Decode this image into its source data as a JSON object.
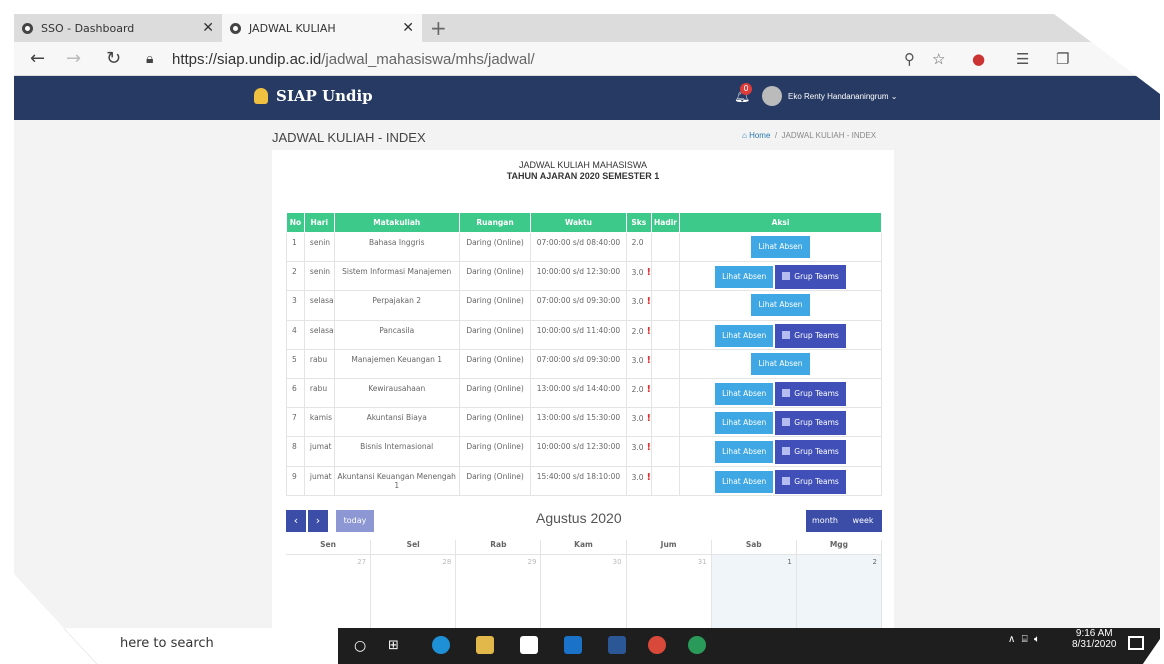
{
  "browser": {
    "tabs": [
      {
        "label": "SSO - Dashboard"
      },
      {
        "label": "JADWAL KULIAH"
      }
    ],
    "url_base": "https://siap.undip.ac.id",
    "url_path": "/jadwal_mahasiswa/mhs/jadwal/"
  },
  "header": {
    "brand": "SIAP Undip",
    "notif_count": "0",
    "user": "Eko Renty Handananingrum"
  },
  "page": {
    "title": "JADWAL KULIAH - INDEX",
    "crumb_home": "Home",
    "crumb_current": "JADWAL KULIAH - INDEX"
  },
  "card": {
    "title1": "JADWAL KULIAH MAHASISWA",
    "title2": "TAHUN AJARAN 2020 SEMESTER 1"
  },
  "table": {
    "headers": [
      "No",
      "Hari",
      "Matakuliah",
      "Ruangan",
      "Waktu",
      "Sks",
      "Hadir",
      "Aksi"
    ],
    "lihat_absen": "Lihat Absen",
    "grup_teams": "Grup Teams",
    "rows": [
      {
        "no": "1",
        "hari": "senin",
        "mk": "Bahasa Inggris",
        "ruang": "Daring (Online)",
        "waktu": "07:00:00 s/d 08:40:00",
        "sks": "2.0",
        "mark": "",
        "teams": false
      },
      {
        "no": "2",
        "hari": "senin",
        "mk": "Sistem Informasi Manajemen",
        "ruang": "Daring (Online)",
        "waktu": "10:00:00 s/d 12:30:00",
        "sks": "3.0",
        "mark": "!",
        "teams": true
      },
      {
        "no": "3",
        "hari": "selasa",
        "mk": "Perpajakan 2",
        "ruang": "Daring (Online)",
        "waktu": "07:00:00 s/d 09:30:00",
        "sks": "3.0",
        "mark": "!",
        "teams": false
      },
      {
        "no": "4",
        "hari": "selasa",
        "mk": "Pancasila",
        "ruang": "Daring (Online)",
        "waktu": "10:00:00 s/d 11:40:00",
        "sks": "2.0",
        "mark": "!",
        "teams": true
      },
      {
        "no": "5",
        "hari": "rabu",
        "mk": "Manajemen Keuangan 1",
        "ruang": "Daring (Online)",
        "waktu": "07:00:00 s/d 09:30:00",
        "sks": "3.0",
        "mark": "!",
        "teams": false
      },
      {
        "no": "6",
        "hari": "rabu",
        "mk": "Kewirausahaan",
        "ruang": "Daring (Online)",
        "waktu": "13:00:00 s/d 14:40:00",
        "sks": "2.0",
        "mark": "!",
        "teams": true
      },
      {
        "no": "7",
        "hari": "kamis",
        "mk": "Akuntansi Biaya",
        "ruang": "Daring (Online)",
        "waktu": "13:00:00 s/d 15:30:00",
        "sks": "3.0",
        "mark": "!",
        "teams": true
      },
      {
        "no": "8",
        "hari": "jumat",
        "mk": "Bisnis Internasional",
        "ruang": "Daring (Online)",
        "waktu": "10:00:00 s/d 12:30:00",
        "sks": "3.0",
        "mark": "!",
        "teams": true
      },
      {
        "no": "9",
        "hari": "jumat",
        "mk": "Akuntansi Keuangan Menengah 1",
        "ruang": "Daring (Online)",
        "waktu": "15:40:00 s/d 18:10:00",
        "sks": "3.0",
        "mark": "!",
        "teams": true
      }
    ]
  },
  "calendar": {
    "prev": "‹",
    "next": "›",
    "today": "today",
    "month": "Agustus 2020",
    "view_month": "month",
    "view_week": "week",
    "days": [
      "Sen",
      "Sel",
      "Rab",
      "Kam",
      "Jum",
      "Sab",
      "Mgg"
    ],
    "first_row": [
      "27",
      "28",
      "29",
      "30",
      "31",
      "1",
      "2"
    ]
  },
  "taskbar": {
    "search": "here to search",
    "time": "9:16 AM",
    "date": "8/31/2020"
  },
  "colors": {
    "header": "#263a63",
    "table_head": "#3dc98a",
    "absen": "#3fa8e4",
    "teams": "#4150b8"
  }
}
